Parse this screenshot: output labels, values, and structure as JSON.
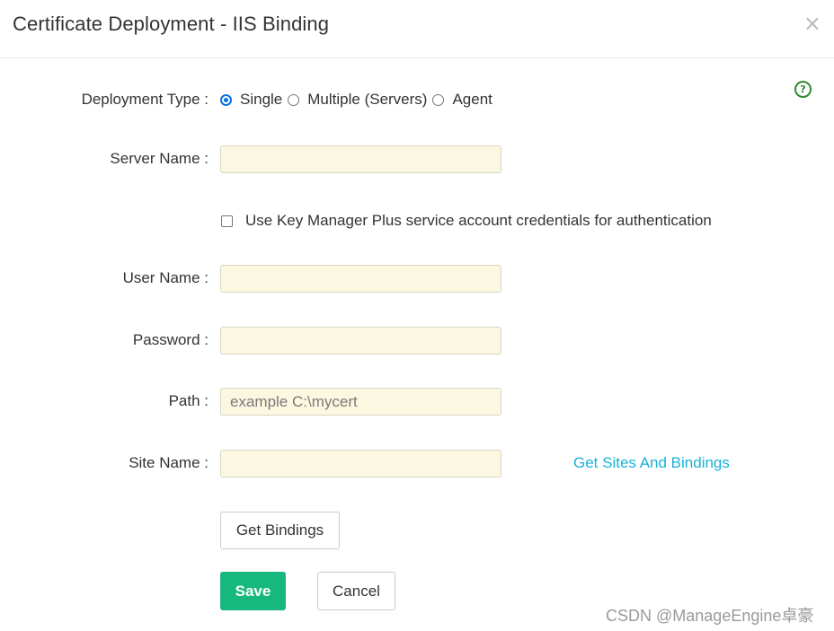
{
  "header": {
    "title": "Certificate Deployment - IIS Binding",
    "close_glyph": "×"
  },
  "help": {
    "glyph": "?",
    "icon": "help-circle-icon"
  },
  "deployment_type": {
    "label": "Deployment Type :",
    "options": [
      "Single",
      "Multiple (Servers)",
      "Agent"
    ],
    "selected": "Single"
  },
  "fields": {
    "server_name": {
      "label": "Server Name :",
      "value": ""
    },
    "user_name": {
      "label": "User Name :",
      "value": ""
    },
    "password": {
      "label": "Password :",
      "value": ""
    },
    "path": {
      "label": "Path :",
      "value": "",
      "placeholder": "example C:\\mycert"
    },
    "site_name": {
      "label": "Site Name :",
      "value": ""
    }
  },
  "credentials_checkbox": {
    "label": "Use Key Manager Plus service account credentials for authentication",
    "checked": false
  },
  "links": {
    "get_sites": "Get Sites And Bindings"
  },
  "buttons": {
    "get_bindings": "Get Bindings",
    "save": "Save",
    "cancel": "Cancel"
  },
  "watermark": "CSDN @ManageEngine卓豪",
  "colors": {
    "accent_save": "#16b87d",
    "link": "#18b2d8",
    "input_bg": "#fcf7e0",
    "help_green": "#2e8b2e",
    "radio_checked": "#0b6fe0"
  }
}
